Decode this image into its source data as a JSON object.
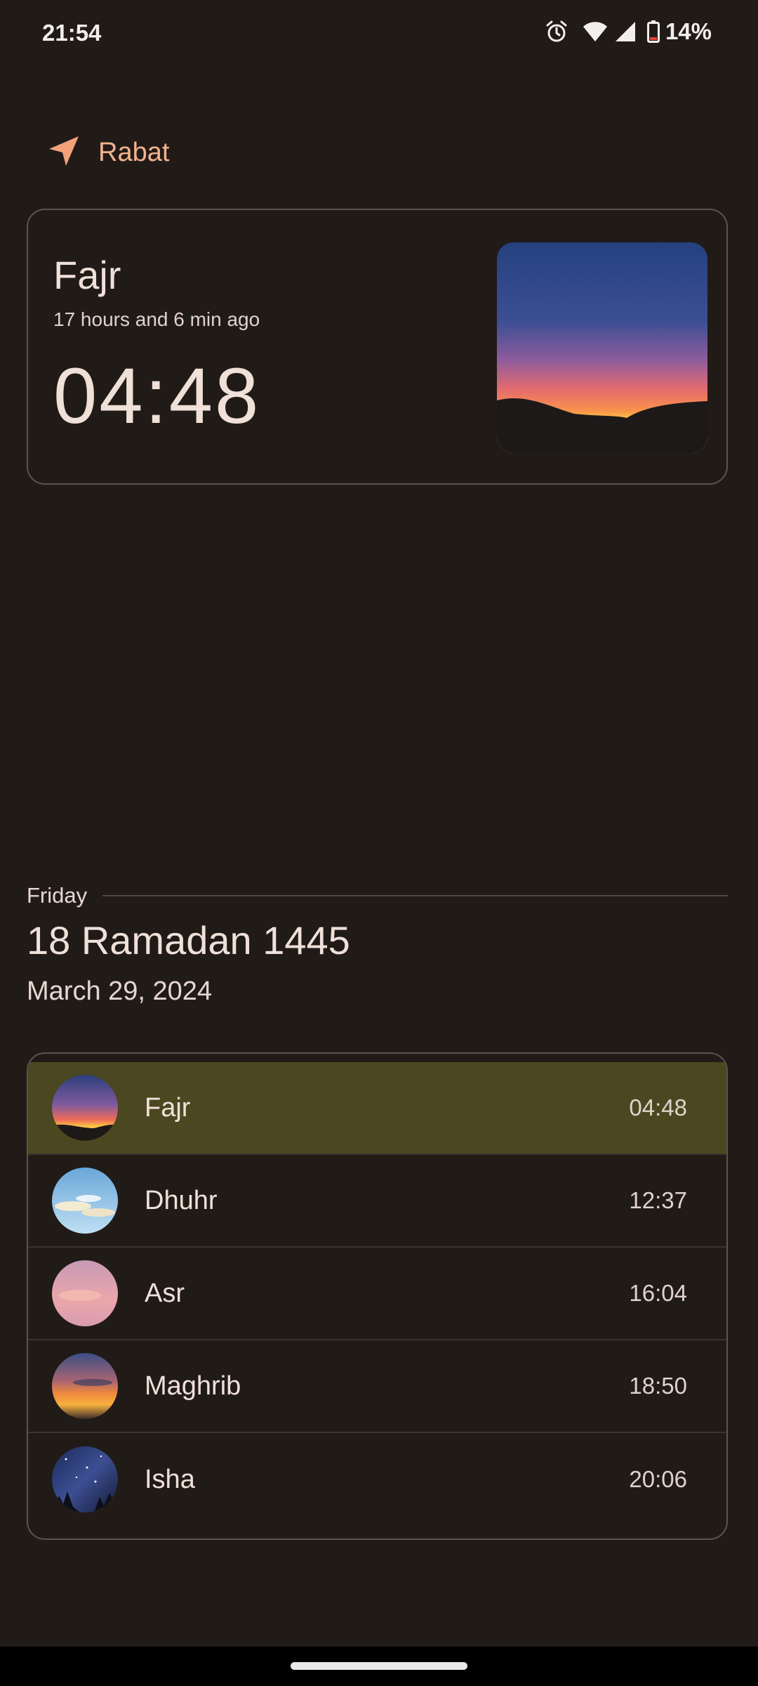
{
  "status_bar": {
    "time": "21:54",
    "battery": "14%",
    "icons": [
      "alarm-icon",
      "wifi-icon",
      "signal-icon",
      "battery-icon"
    ]
  },
  "location": {
    "icon": "navigation-arrow-icon",
    "label": "Rabat",
    "accent_color": "#f3a27a"
  },
  "current_prayer": {
    "name": "Fajr",
    "ago": "17 hours and 6 min ago",
    "time": "04:48",
    "image": "dawn-sky-image"
  },
  "date": {
    "weekday": "Friday",
    "hijri": "18 Ramadan 1445",
    "gregorian": "March 29, 2024"
  },
  "prayers": [
    {
      "name": "Fajr",
      "time": "04:48",
      "image": "dawn-image",
      "active": true
    },
    {
      "name": "Dhuhr",
      "time": "12:37",
      "image": "day-sky-image",
      "active": false
    },
    {
      "name": "Asr",
      "time": "16:04",
      "image": "afternoon-sky-image",
      "active": false
    },
    {
      "name": "Maghrib",
      "time": "18:50",
      "image": "sunset-image",
      "active": false
    },
    {
      "name": "Isha",
      "time": "20:06",
      "image": "night-sky-image",
      "active": false
    }
  ],
  "colors": {
    "background": "#211b18",
    "active_row": "#4b4720",
    "card_border": "#5b534f"
  }
}
